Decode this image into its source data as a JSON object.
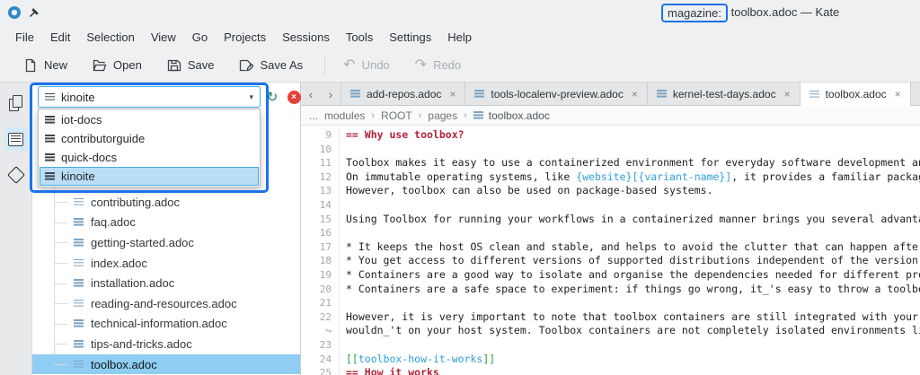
{
  "titlebar": {
    "prefix": "magazine:",
    "rest": " toolbox.adoc — Kate"
  },
  "menubar": {
    "items": [
      "File",
      "Edit",
      "Selection",
      "View",
      "Go",
      "Projects",
      "Sessions",
      "Tools",
      "Settings",
      "Help"
    ]
  },
  "toolbar": {
    "new_label": "New",
    "open_label": "Open",
    "save_label": "Save",
    "save_as_label": "Save As",
    "undo_label": "Undo",
    "redo_label": "Redo"
  },
  "icons": {
    "close": "×",
    "chevron_down": "▾",
    "refresh": "↻",
    "stop": "×",
    "back": "‹",
    "forward": "›",
    "undo": "↶",
    "redo": "↷"
  },
  "project_selector": {
    "value": "kinoite",
    "options": [
      "iot-docs",
      "contributorguide",
      "quick-docs",
      "kinoite"
    ],
    "selected_option": "kinoite"
  },
  "file_tree": {
    "items": [
      "contributing.adoc",
      "faq.adoc",
      "getting-started.adoc",
      "index.adoc",
      "installation.adoc",
      "reading-and-resources.adoc",
      "technical-information.adoc",
      "tips-and-tricks.adoc",
      "toolbox.adoc"
    ],
    "selected_item": "toolbox.adoc"
  },
  "tabs": [
    {
      "label": "add-repos.adoc"
    },
    {
      "label": "tools-localenv-preview.adoc"
    },
    {
      "label": "kernel-test-days.adoc"
    },
    {
      "label": "toolbox.adoc"
    }
  ],
  "breadcrumb": {
    "overflow": "...",
    "items": [
      "modules",
      "ROOT",
      "pages"
    ],
    "separator": "›",
    "file": "toolbox.adoc"
  },
  "editor": {
    "lines": [
      {
        "gutter": "9",
        "text": "== Why use toolbox?"
      },
      {
        "gutter": "10",
        "text": ""
      },
      {
        "gutter": "11",
        "text": "Toolbox makes it easy to use a containerized environment for everyday software development and testing."
      },
      {
        "gutter": "12",
        "pre": "On immutable operating systems, like ",
        "token": "{website}[{variant-name}]",
        "post": ", it provides a familiar package manager experience."
      },
      {
        "gutter": "13",
        "text": "However, toolbox can also be used on package-based systems."
      },
      {
        "gutter": "14",
        "text": ""
      },
      {
        "gutter": "15",
        "text": "Using Toolbox for running your workflows in a containerized manner brings you several advantages:"
      },
      {
        "gutter": "16",
        "text": ""
      },
      {
        "gutter": "17",
        "text": "* It keeps the host OS clean and stable, and helps to avoid the clutter that can happen after installing software."
      },
      {
        "gutter": "18",
        "text": "* You get access to different versions of supported distributions independent of the version you are running."
      },
      {
        "gutter": "19",
        "text": "* Containers are a good way to isolate and organise the dependencies needed for different projects."
      },
      {
        "gutter": "20",
        "text": "* Containers are a safe space to experiment: if things go wrong, it_'s easy to throw a toolbox away and start over."
      },
      {
        "gutter": "21",
        "text": ""
      },
      {
        "gutter": "22",
        "text": "However, it is very important to note that toolbox containers are still integrated with your host system, and commands can affect it in ways they"
      },
      {
        "gutter": "↪",
        "text": "wouldn_'t on your host system. Toolbox containers are not completely isolated environments like virtual machines."
      },
      {
        "gutter": "23",
        "text": ""
      },
      {
        "gutter": "24",
        "anchor_open": "[[",
        "anchor_text": "toolbox-how-it-works",
        "anchor_close": "]]"
      },
      {
        "gutter": "25",
        "text": "== How it works"
      }
    ]
  },
  "colors": {
    "accent": "#3daee9",
    "annotation": "#1a73e8",
    "heading_red": "#b02438",
    "token_blue": "#2d9fd8",
    "anchor_green": "#229a3e",
    "stop_red": "#e8403a"
  }
}
